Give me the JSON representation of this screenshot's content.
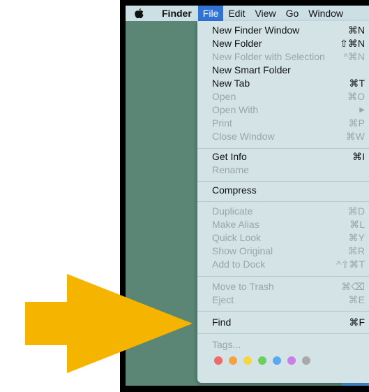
{
  "menubar": {
    "apple_icon": "apple-icon",
    "app_name": "Finder",
    "items": [
      "File",
      "Edit",
      "View",
      "Go",
      "Window"
    ],
    "active_item": "File"
  },
  "file_menu": {
    "new_finder_window": {
      "label": "New Finder Window",
      "shortcut": "⌘N",
      "enabled": true
    },
    "new_folder": {
      "label": "New Folder",
      "shortcut": "⇧⌘N",
      "enabled": true
    },
    "new_folder_with_selection": {
      "label": "New Folder with Selection",
      "shortcut": "^⌘N",
      "enabled": false
    },
    "new_smart_folder": {
      "label": "New Smart Folder",
      "shortcut": "",
      "enabled": true
    },
    "new_tab": {
      "label": "New Tab",
      "shortcut": "⌘T",
      "enabled": true
    },
    "open": {
      "label": "Open",
      "shortcut": "⌘O",
      "enabled": false
    },
    "open_with": {
      "label": "Open With",
      "shortcut": "▶",
      "enabled": false
    },
    "print": {
      "label": "Print",
      "shortcut": "⌘P",
      "enabled": false
    },
    "close_window": {
      "label": "Close Window",
      "shortcut": "⌘W",
      "enabled": false
    },
    "get_info": {
      "label": "Get Info",
      "shortcut": "⌘I",
      "enabled": true
    },
    "rename": {
      "label": "Rename",
      "shortcut": "",
      "enabled": false
    },
    "compress": {
      "label": "Compress",
      "shortcut": "",
      "enabled": true
    },
    "duplicate": {
      "label": "Duplicate",
      "shortcut": "⌘D",
      "enabled": false
    },
    "make_alias": {
      "label": "Make Alias",
      "shortcut": "⌘L",
      "enabled": false
    },
    "quick_look": {
      "label": "Quick Look",
      "shortcut": "⌘Y",
      "enabled": false
    },
    "show_original": {
      "label": "Show Original",
      "shortcut": "⌘R",
      "enabled": false
    },
    "add_to_dock": {
      "label": "Add to Dock",
      "shortcut": "^⇧⌘T",
      "enabled": false
    },
    "move_to_trash": {
      "label": "Move to Trash",
      "shortcut": "⌘⌫",
      "enabled": false
    },
    "eject": {
      "label": "Eject",
      "shortcut": "⌘E",
      "enabled": false
    },
    "find": {
      "label": "Find",
      "shortcut": "⌘F",
      "enabled": true
    },
    "tags": {
      "label": "Tags...",
      "enabled": false
    }
  },
  "tag_colors": [
    "#f06a6a",
    "#f5a142",
    "#f5d742",
    "#6ccf5e",
    "#5aa8f0",
    "#c780e8",
    "#a9a9a9"
  ],
  "annotation": {
    "arrow_color": "#f5b400",
    "arrow_icon": "right-arrow-icon"
  }
}
